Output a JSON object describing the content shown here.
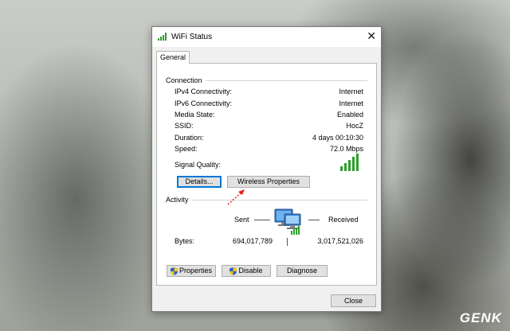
{
  "window": {
    "title": "WiFi Status",
    "close_glyph": "✕"
  },
  "tabs": [
    {
      "label": "General",
      "selected": true
    }
  ],
  "connection": {
    "heading": "Connection",
    "rows": [
      {
        "label": "IPv4 Connectivity:",
        "value": "Internet"
      },
      {
        "label": "IPv6 Connectivity:",
        "value": "Internet"
      },
      {
        "label": "Media State:",
        "value": "Enabled"
      },
      {
        "label": "SSID:",
        "value": "HocZ"
      },
      {
        "label": "Duration:",
        "value": "4 days 00:10:30"
      },
      {
        "label": "Speed:",
        "value": "72.0 Mbps"
      }
    ],
    "signal_label": "Signal Quality:",
    "signal_bars_active": 5,
    "signal_bars_total": 5
  },
  "buttons": {
    "details": "Details...",
    "wireless_properties": "Wireless Properties",
    "properties": "Properties",
    "disable": "Disable",
    "diagnose": "Diagnose",
    "close": "Close"
  },
  "activity": {
    "heading": "Activity",
    "sent_label": "Sent",
    "received_label": "Received",
    "bytes_label": "Bytes:",
    "bytes_sent": "694,017,789",
    "bytes_received": "3,017,521,026"
  },
  "watermark": "GENK",
  "colors": {
    "signal_green": "#2e9e2e",
    "focus_blue": "#0078d7",
    "hint_red": "#e02020"
  },
  "icons": {
    "title": "wifi-signal-icon",
    "network": "network-computers-icon",
    "shield": "uac-shield-icon"
  }
}
